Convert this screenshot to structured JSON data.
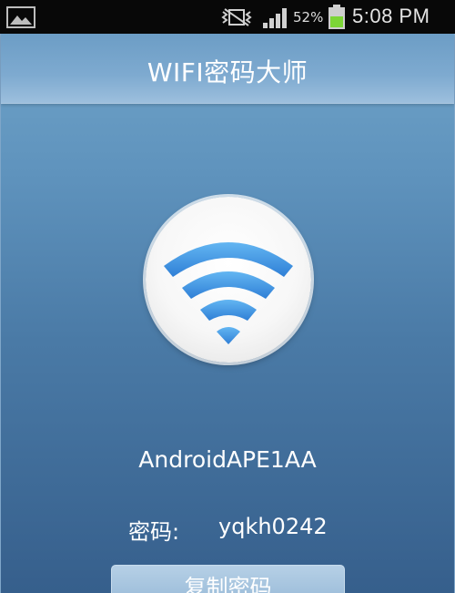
{
  "status_bar": {
    "battery_percent": "52%",
    "time": "5:08 PM",
    "icons": [
      "image-notification-icon",
      "vibrate-mute-icon",
      "signal-bars-icon",
      "battery-charging-icon"
    ],
    "battery_color": "#7cd636"
  },
  "app": {
    "title": "WIFI密码大师",
    "network_name": "AndroidAPE1AA",
    "password_label": "密码:",
    "password_value": "yqkh0242",
    "copy_button_label": "复制密码",
    "logo_icon": "wifi-icon",
    "accent_color": "#4a7aa6"
  }
}
